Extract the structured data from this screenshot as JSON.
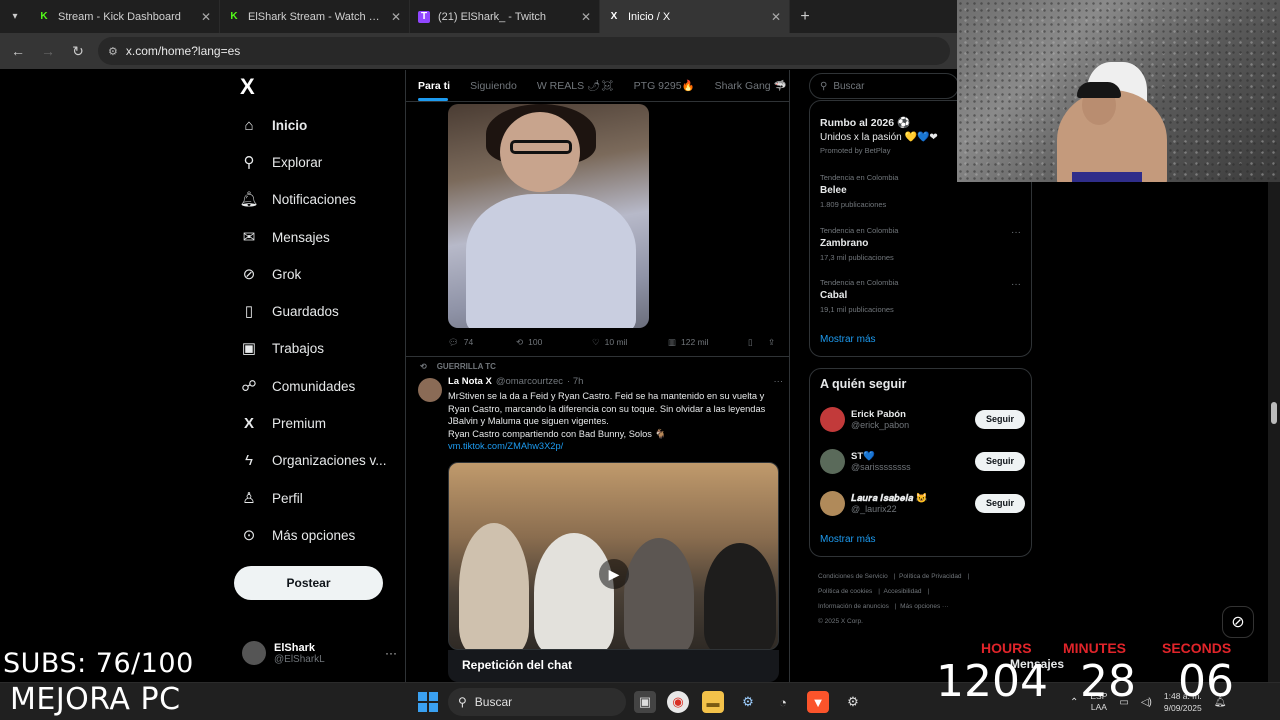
{
  "browser": {
    "tabs": [
      {
        "title": "Stream - Kick Dashboard",
        "favicon": "K",
        "color": "#53fc18",
        "active": false
      },
      {
        "title": "ElShark Stream - Watch Live on",
        "favicon": "K",
        "color": "#53fc18",
        "active": false
      },
      {
        "title": "(21) ElShark_ - Twitch",
        "favicon": "T",
        "color": "#9146ff",
        "active": false
      },
      {
        "title": "Inicio / X",
        "favicon": "X",
        "color": "#ffffff",
        "active": true
      }
    ],
    "new_tab": "+",
    "url": "x.com/home?lang=es"
  },
  "nav": {
    "items": [
      {
        "label": "Inicio",
        "icon": "home-icon",
        "glyph": "⌂"
      },
      {
        "label": "Explorar",
        "icon": "search-icon",
        "glyph": "⚲"
      },
      {
        "label": "Notificaciones",
        "icon": "bell-icon",
        "glyph": "♫"
      },
      {
        "label": "Mensajes",
        "icon": "mail-icon",
        "glyph": "✉"
      },
      {
        "label": "Grok",
        "icon": "grok-icon",
        "glyph": "⊘"
      },
      {
        "label": "Guardados",
        "icon": "bookmark-icon",
        "glyph": "▯"
      },
      {
        "label": "Trabajos",
        "icon": "briefcase-icon",
        "glyph": "▣"
      },
      {
        "label": "Comunidades",
        "icon": "people-icon",
        "glyph": "☍"
      },
      {
        "label": "Premium",
        "icon": "x-icon",
        "glyph": "X"
      },
      {
        "label": "Organizaciones v...",
        "icon": "lightning-icon",
        "glyph": "ϟ"
      },
      {
        "label": "Perfil",
        "icon": "person-icon",
        "glyph": "♙"
      },
      {
        "label": "Más opciones",
        "icon": "more-icon",
        "glyph": "⊙"
      }
    ],
    "post_button": "Postear",
    "profile": {
      "name": "ElShark",
      "handle": "@ElSharkL"
    }
  },
  "timeline": {
    "tabs": [
      "Para ti",
      "Siguiendo",
      "W REALS 🌶☠",
      "PTG 9295🔥",
      "Shark Gang 🦈"
    ],
    "tweet1_actions": {
      "replies": "74",
      "reposts": "100",
      "likes": "10 mil",
      "views": "122 mil"
    },
    "tweet2": {
      "repost_by": "GUERRILLA TC",
      "name": "La Nota X",
      "handle": "@omarcourtzec",
      "time": "· 7h",
      "text": "MrStiven se la da a Feid y Ryan Castro. Feid se ha mantenido en su vuelta y Ryan Castro, marcando la diferencia con su toque. Sin olvidar a las leyendas JBalvin y Maluma que siguen vigentes.",
      "text2": "Ryan Castro compartiendo con Bad Bunny, Solos 🐐",
      "link": "vm.tiktok.com/ZMAhw3X2p/",
      "chat_replay": "Repetición del chat"
    }
  },
  "sidebar": {
    "search_placeholder": "Buscar",
    "promo": {
      "title": "Rumbo al 2026 ⚽",
      "subtitle": "Unidos x la pasión 💛💙❤",
      "tag": "Promoted by BetPlay"
    },
    "trends": [
      {
        "meta": "Tendencia en Colombia",
        "title": "Belee",
        "count": "1.809 publicaciones"
      },
      {
        "meta": "Tendencia en Colombia",
        "title": "Zambrano",
        "count": "17,3 mil publicaciones"
      },
      {
        "meta": "Tendencia en Colombia",
        "title": "Cabal",
        "count": "19,1 mil publicaciones"
      }
    ],
    "show_more": "Mostrar más",
    "follow": {
      "title": "A quién seguir",
      "button": "Seguir",
      "users": [
        {
          "name": "Erick Pabón",
          "handle": "@erick_pabon",
          "color": "#c23a3a"
        },
        {
          "name": "ST💙",
          "handle": "@sarissssssss",
          "color": "#5a6a5a"
        },
        {
          "name": "𝑳𝒂𝒖𝒓𝒂 𝑰𝒔𝒂𝒃𝒆𝒍𝒂 😺",
          "handle": "@_laurix22",
          "color": "#b08a5a"
        }
      ]
    },
    "footer": [
      "Condiciones de Servicio",
      "Política de Privacidad",
      "Política de cookies",
      "Accesibilidad",
      "Información de anuncios",
      "Más opciones ···",
      "© 2025 X Corp."
    ]
  },
  "overlay": {
    "subs": "SUBS: 76/100",
    "mejora": "MEJORA PC",
    "mensajes": "Mensajes",
    "timer": [
      {
        "label": "HOURS",
        "value": "1204"
      },
      {
        "label": "MINUTES",
        "value": "28"
      },
      {
        "label": "SECONDS",
        "value": "06"
      }
    ],
    "timer_color": "#e0242a"
  },
  "taskbar": {
    "search": "Buscar",
    "lang": "ESP",
    "lang2": "LAA",
    "time": "1:48 a. m.",
    "date": "9/09/2025"
  }
}
